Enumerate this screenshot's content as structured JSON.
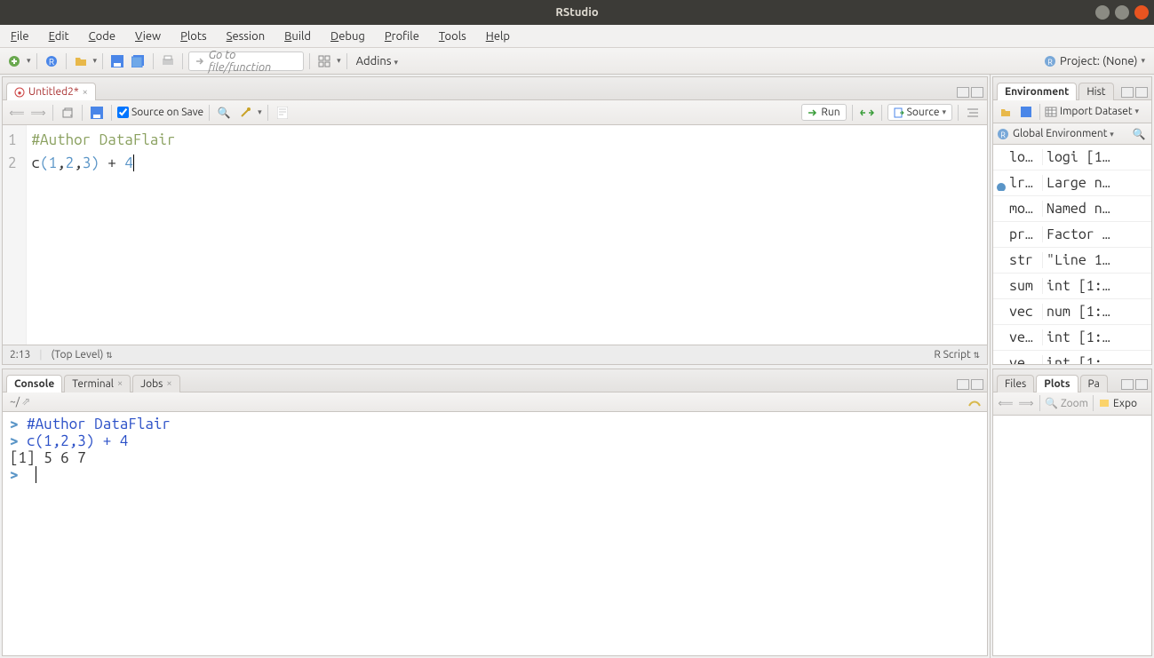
{
  "titlebar": {
    "title": "RStudio"
  },
  "menu": [
    "File",
    "Edit",
    "Code",
    "View",
    "Plots",
    "Session",
    "Build",
    "Debug",
    "Profile",
    "Tools",
    "Help"
  ],
  "toolbar": {
    "goto_placeholder": "Go to file/function",
    "addins": "Addins",
    "project": "Project: (None)"
  },
  "source": {
    "tab_name": "Untitled2*",
    "source_on_save": "Source on Save",
    "run": "Run",
    "source_btn": "Source",
    "pos": "2:13",
    "scope": "(Top Level)",
    "lang": "R Script",
    "lines": [
      {
        "n": 1,
        "tokens": [
          {
            "t": "#Author DataFlair",
            "c": "comment"
          }
        ]
      },
      {
        "n": 2,
        "tokens": [
          {
            "t": "c",
            "c": "func"
          },
          {
            "t": "(",
            "c": "paren"
          },
          {
            "t": "1",
            "c": "num"
          },
          {
            "t": ",",
            "c": "op"
          },
          {
            "t": "2",
            "c": "num"
          },
          {
            "t": ",",
            "c": "op"
          },
          {
            "t": "3",
            "c": "num"
          },
          {
            "t": ")",
            "c": "paren"
          },
          {
            "t": " + ",
            "c": "op"
          },
          {
            "t": "4",
            "c": "num"
          }
        ]
      }
    ]
  },
  "console": {
    "tabs": [
      "Console",
      "Terminal",
      "Jobs"
    ],
    "path": "~/",
    "lines": [
      {
        "kind": "cmd",
        "text": "#Author DataFlair"
      },
      {
        "kind": "cmd",
        "text": "c(1,2,3) + 4"
      },
      {
        "kind": "out",
        "text": "[1] 5 6 7"
      },
      {
        "kind": "prompt",
        "text": ""
      }
    ]
  },
  "env": {
    "tabs": [
      "Environment",
      "History"
    ],
    "import": "Import Dataset",
    "scope": "Global Environment",
    "rows": [
      {
        "name": "lo…",
        "value": "logi [1…",
        "dot": false
      },
      {
        "name": "lr…",
        "value": "Large n…",
        "dot": true
      },
      {
        "name": "mo…",
        "value": "Named n…",
        "dot": false
      },
      {
        "name": "pr…",
        "value": "Factor …",
        "dot": false
      },
      {
        "name": "str",
        "value": "\"Line 1…",
        "dot": false
      },
      {
        "name": "sum",
        "value": "int [1:…",
        "dot": false
      },
      {
        "name": "vec",
        "value": "num [1:…",
        "dot": false
      },
      {
        "name": "ve…",
        "value": "int [1:…",
        "dot": false
      },
      {
        "name": "ve…",
        "value": "int [1:…",
        "dot": false
      }
    ]
  },
  "plots": {
    "tabs": [
      "Files",
      "Plots",
      "Packages"
    ],
    "zoom": "Zoom",
    "export": "Export"
  }
}
